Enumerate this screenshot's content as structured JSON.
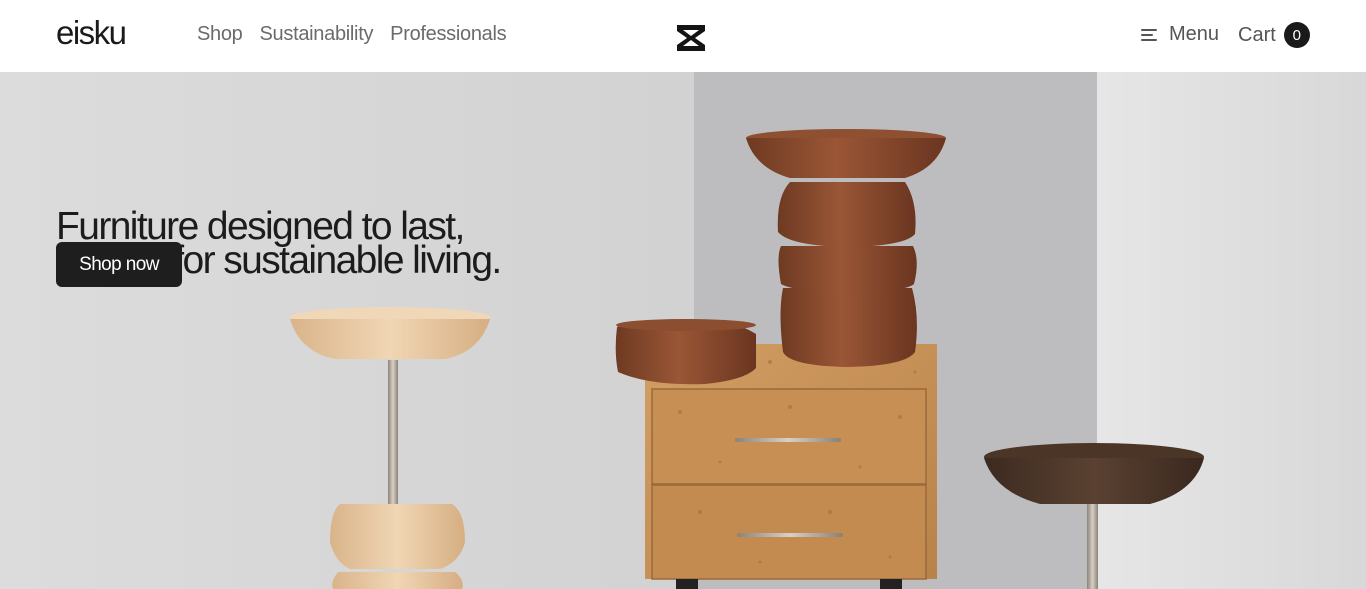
{
  "header": {
    "logo_text": "eisku",
    "nav": [
      {
        "label": "Shop"
      },
      {
        "label": "Sustainability"
      },
      {
        "label": "Professionals"
      }
    ],
    "center_icon": "hourglass-logo-icon",
    "menu_label": "Menu",
    "menu_icon": "hamburger-icon",
    "cart_label": "Cart",
    "cart_count": "0"
  },
  "hero": {
    "headline_line1": "Furniture designed to last,",
    "headline_line2": "crafted for sustainable living.",
    "cta_label": "Shop now",
    "image_subject": "wooden and cork furniture product photo"
  },
  "colors": {
    "text": "#1a1a1a",
    "nav_text": "#6b6b6b",
    "button_bg": "#1e1e1e",
    "hero_bg": "#dadada",
    "walnut": "#8a4a2c",
    "cork": "#c9935b",
    "maple": "#e7c9a3"
  }
}
